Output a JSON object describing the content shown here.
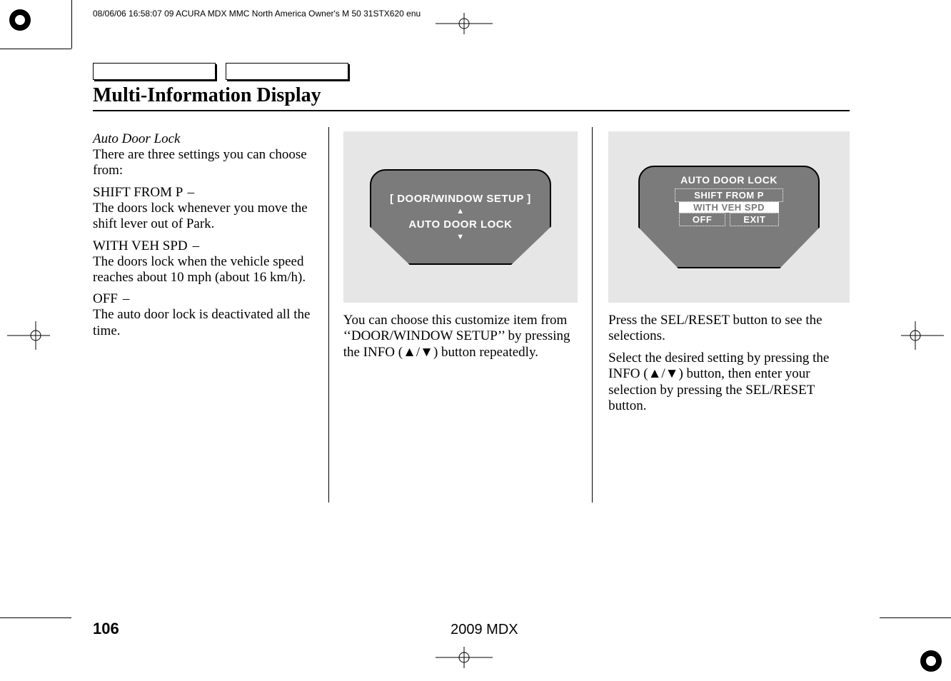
{
  "meta": {
    "header_line": "08/06/06 16:58:07    09 ACURA MDX MMC North America Owner's M 50 31STX620 enu"
  },
  "section_title": "Multi-Information Display",
  "col1": {
    "subhead": "Auto Door Lock",
    "intro": "There are three settings you can choose from:",
    "opt1_title": "SHIFT FROM P",
    "opt1_dash": "–",
    "opt1_desc": "The doors lock whenever you move the shift lever out of Park.",
    "opt2_title": "WITH VEH SPD",
    "opt2_dash": "–",
    "opt2_desc": "The doors lock when the vehicle speed reaches about 10 mph (about 16 km/h).",
    "opt3_title": "OFF",
    "opt3_dash": "–",
    "opt3_desc": "The auto door lock is deactivated all the time."
  },
  "col2": {
    "illus": {
      "line1": "[ DOOR/WINDOW SETUP ]",
      "arrow_up": "▲",
      "line2": "AUTO DOOR LOCK",
      "arrow_down": "▼"
    },
    "para": "You can choose this customize item from ‘‘DOOR/WINDOW SETUP’’ by pressing the INFO (▲/▼) button repeatedly."
  },
  "col3": {
    "illus": {
      "title": "AUTO DOOR LOCK",
      "row1": "SHIFT FROM P",
      "row2": "WITH VEH SPD",
      "row3a": "OFF",
      "row3b": "EXIT"
    },
    "para1": "Press the SEL/RESET button to see the selections.",
    "para2": "Select the desired setting by pressing the INFO (▲/▼) button, then enter your selection by pressing the SEL/RESET button."
  },
  "footer": {
    "page": "106",
    "model": "2009  MDX"
  }
}
